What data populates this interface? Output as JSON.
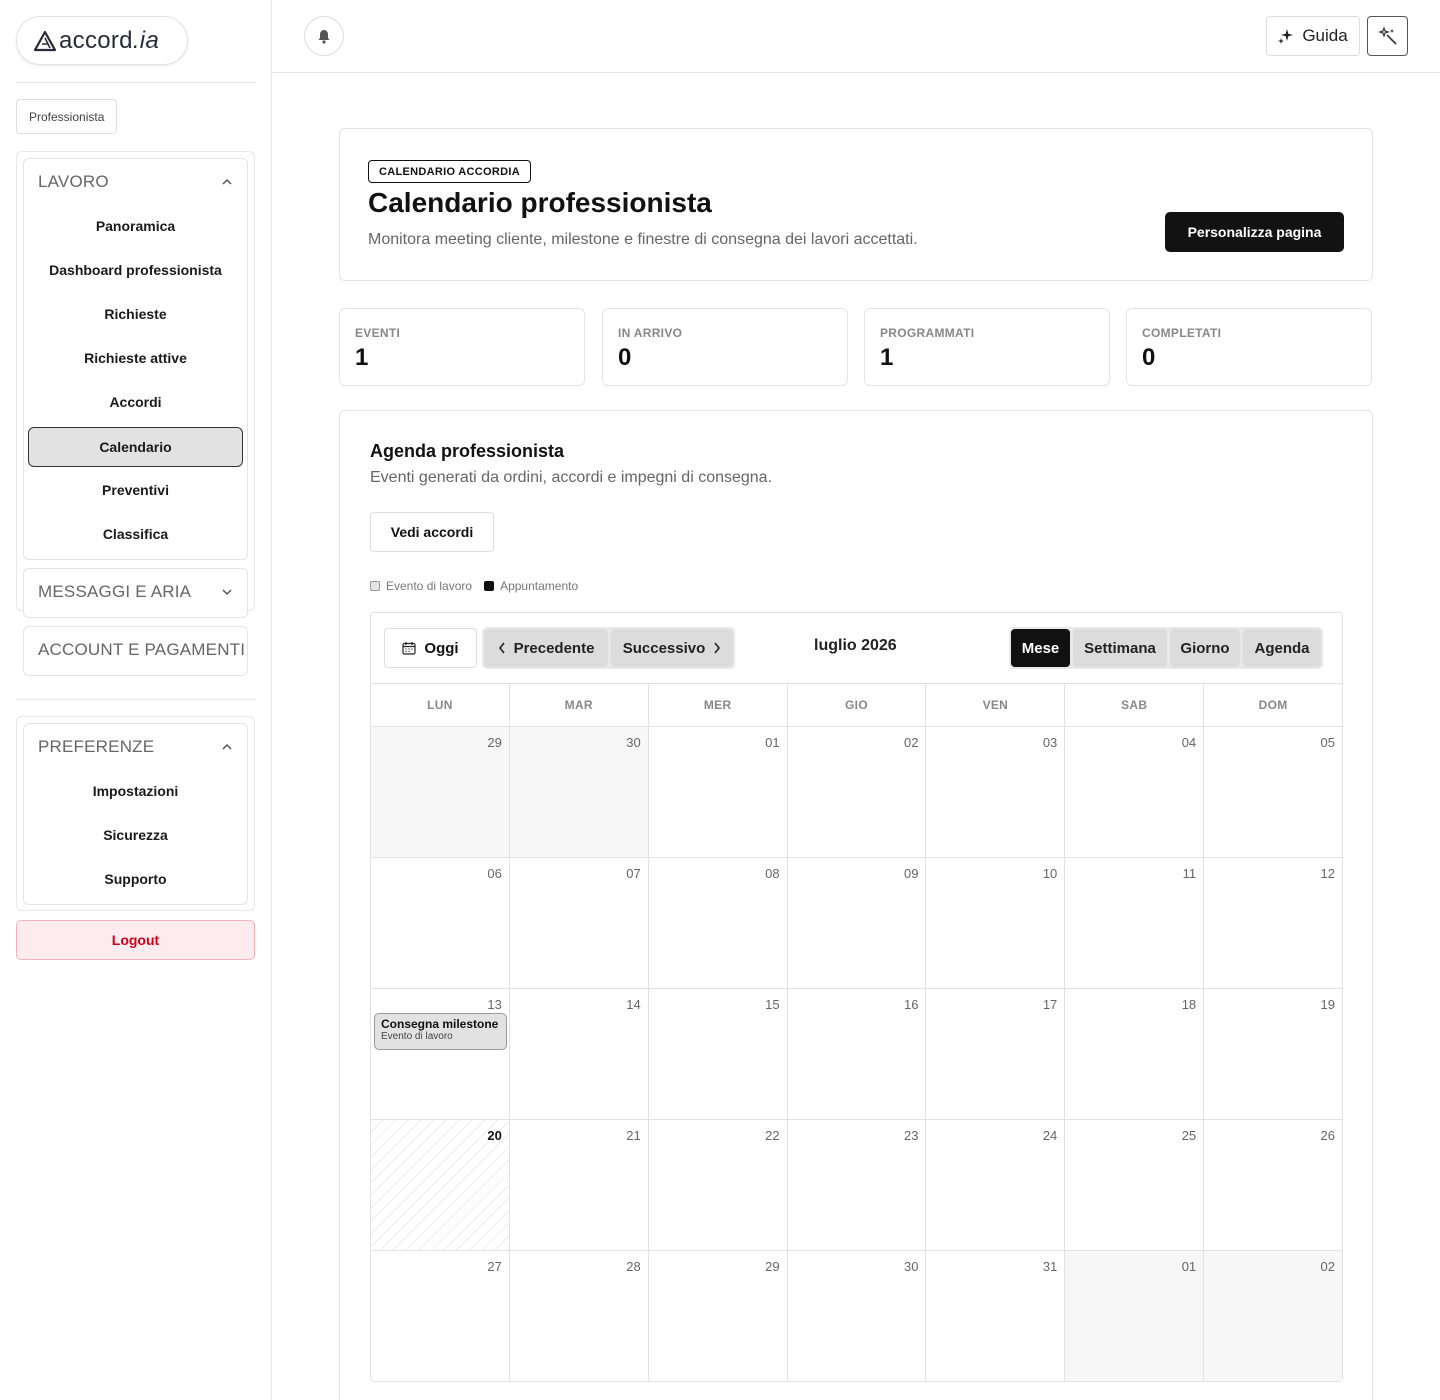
{
  "brand": {
    "name": "accord",
    "suffix": ".ia"
  },
  "sidebar": {
    "role": "Professionista",
    "groups": [
      {
        "title": "LAVORO",
        "expanded": true,
        "items": [
          "Panoramica",
          "Dashboard professionista",
          "Richieste",
          "Richieste attive",
          "Accordi",
          "Calendario",
          "Preventivi",
          "Classifica"
        ]
      },
      {
        "title": "MESSAGGI E ARIA",
        "expanded": false,
        "items": []
      },
      {
        "title": "ACCOUNT E PAGAMENTI",
        "expanded": false,
        "items": []
      },
      {
        "title": "PREFERENZE",
        "expanded": true,
        "items": [
          "Impostazioni",
          "Sicurezza",
          "Supporto"
        ]
      }
    ],
    "active_item": "Calendario",
    "logout": "Logout"
  },
  "topbar": {
    "guida": "Guida"
  },
  "hero": {
    "tag": "CALENDARIO ACCORDIA",
    "title": "Calendario professionista",
    "subtitle": "Monitora meeting cliente, milestone e finestre di consegna dei lavori accettati.",
    "customize": "Personalizza pagina"
  },
  "stats": [
    {
      "label": "EVENTI",
      "value": "1"
    },
    {
      "label": "IN ARRIVO",
      "value": "0"
    },
    {
      "label": "PROGRAMMATI",
      "value": "1"
    },
    {
      "label": "COMPLETATI",
      "value": "0"
    }
  ],
  "agenda": {
    "title": "Agenda professionista",
    "subtitle": "Eventi generati da ordini, accordi e impegni di consegna.",
    "view_button": "Vedi accordi",
    "legend": [
      "Evento di lavoro",
      "Appuntamento"
    ]
  },
  "calendar": {
    "today_label": "Oggi",
    "prev_label": "Precedente",
    "next_label": "Successivo",
    "month_label": "luglio 2026",
    "views": [
      "Mese",
      "Settimana",
      "Giorno",
      "Agenda"
    ],
    "active_view": "Mese",
    "weekdays": [
      "LUN",
      "MAR",
      "MER",
      "GIO",
      "VEN",
      "SAB",
      "DOM"
    ],
    "weeks": [
      [
        "29",
        "30",
        "01",
        "02",
        "03",
        "04",
        "05"
      ],
      [
        "06",
        "07",
        "08",
        "09",
        "10",
        "11",
        "12"
      ],
      [
        "13",
        "14",
        "15",
        "16",
        "17",
        "18",
        "19"
      ],
      [
        "20",
        "21",
        "22",
        "23",
        "24",
        "25",
        "26"
      ],
      [
        "27",
        "28",
        "29",
        "30",
        "31",
        "01",
        "02"
      ]
    ],
    "today": "20",
    "event": {
      "day": "13",
      "title": "Consegna milestone",
      "type": "Evento di lavoro"
    }
  }
}
